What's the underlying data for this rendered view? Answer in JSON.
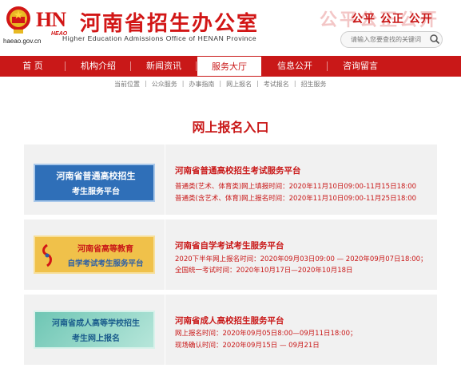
{
  "header": {
    "site_url": "haeao.gov.cn",
    "logo_letters": "HN",
    "logo_sub": "HEAO",
    "title": "河南省招生办公室",
    "title_en": "Higher Education Admissions Office of HENAN Province",
    "slogan_ghost": "公平公正公开",
    "slogan": "公平 公正 公开",
    "search_placeholder": "请输入您要查找的关键词"
  },
  "nav": {
    "items": [
      {
        "label": "首 页",
        "active": false
      },
      {
        "label": "机构介绍",
        "active": false
      },
      {
        "label": "新闻资讯",
        "active": false
      },
      {
        "label": "服务大厅",
        "active": true
      },
      {
        "label": "信息公开",
        "active": false
      },
      {
        "label": "咨询留言",
        "active": false
      }
    ]
  },
  "breadcrumb": [
    "当前位置",
    "公众服务",
    "办事指南",
    "网上报名",
    "考试报名",
    "招生服务"
  ],
  "page_title": "网上报名入口",
  "cards": [
    {
      "banner_line1": "河南省普通高校招生",
      "banner_line2": "考生服务平台",
      "title": "河南省普通高校招生考试服务平台",
      "line1": "普通类(艺术、体育类)网上填报时间：2020年11月10日09:00-11月15日18:00",
      "line2": "普通类(含艺术、体育)网上报名时间：2020年11月10日09:00-11月25日18:00"
    },
    {
      "banner_line1": "河南省高等教育",
      "banner_line2": "自学考试考生服务平台",
      "title": "河南省自学考试考生服务平台",
      "line1": "2020下半年网上报名时间：2020年09月03日09:00 — 2020年09月07日18:00；",
      "line2": "全国统一考试时间：2020年10月17日—2020年10月18日"
    },
    {
      "banner_line1": "河南省成人高等学校招生",
      "banner_line2": "考生网上报名",
      "title": "河南省成人高校招生服务平台",
      "line1": "网上报名时间：2020年09月05日8:00—09月11日18:00；",
      "line2": "现场确认时间：2020年09月15日 — 09月21日"
    }
  ],
  "colors": {
    "brand_red": "#c91818",
    "banner1_bg": "#2f6fb8",
    "banner2_bg": "#f0c14a",
    "banner3_bg": "#8ed2c0"
  }
}
